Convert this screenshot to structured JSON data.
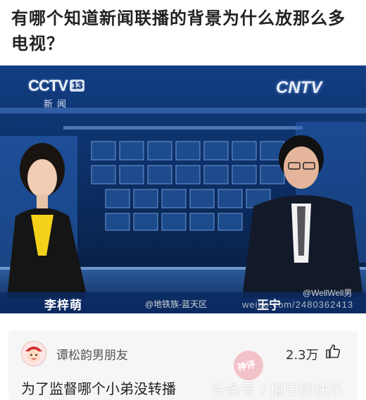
{
  "post": {
    "title": "有哪个知道新闻联播的背景为什么放那么多电视？"
  },
  "photo": {
    "logo_left_text": "CCTV",
    "logo_left_channel": "13",
    "logo_left_subtitle": "新闻",
    "logo_right_text": "CNTV",
    "caption_left_name": "李梓萌",
    "caption_right_name": "王宁",
    "watermark_left": "@地铁族-蓝天区",
    "watermark_right_top": "@WellWell男",
    "watermark_right_bottom": "weibo.com/2480362413"
  },
  "comment": {
    "username": "谭松韵男朋友",
    "likes": "2.3万",
    "text": "为了监督哪个小弟没转播",
    "like_icon": "thumbs-up-icon",
    "avatar_icon": "cartoon-avatar-icon"
  },
  "overlay": {
    "stamp_text": "神评",
    "watermark_text": "头条号 / 值日的快乐"
  },
  "colors": {
    "studio_blue": "#0c2f66",
    "comment_bg": "#f6f6f6",
    "stamp_pink": "#f2b8bf"
  }
}
